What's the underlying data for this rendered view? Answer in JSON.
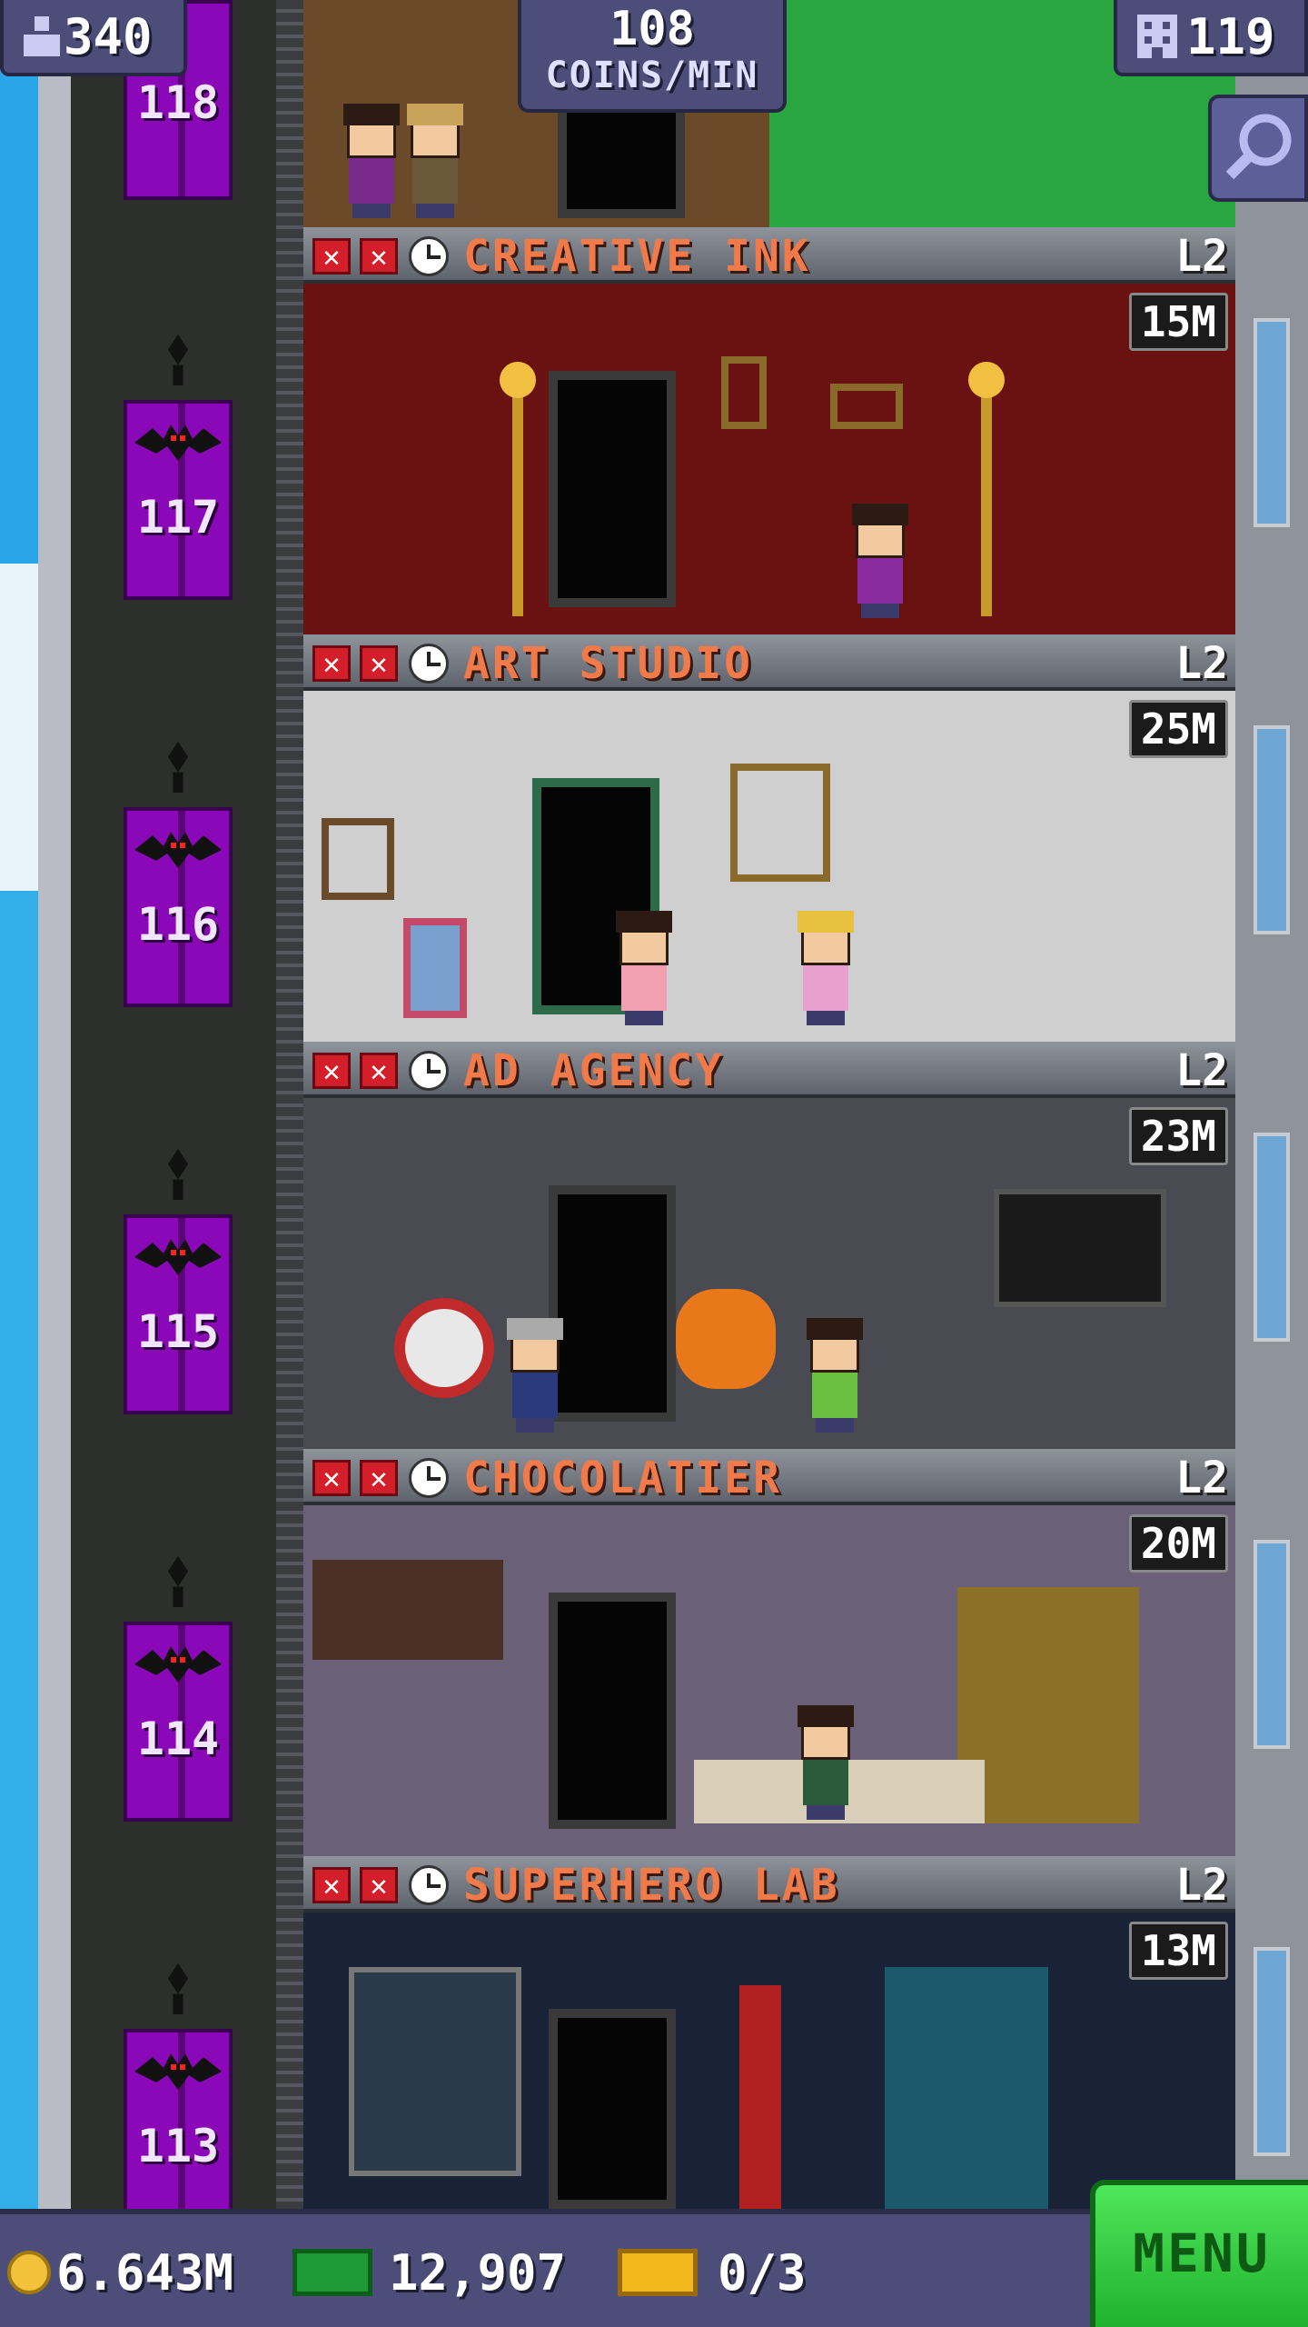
{
  "hud": {
    "population": "340",
    "coins_per_min_value": "108",
    "coins_per_min_label": "COINS/MIN",
    "floors_count": "119"
  },
  "elevator": {
    "floors": [
      "118",
      "117",
      "116",
      "115",
      "114",
      "113"
    ]
  },
  "floors": [
    {
      "name": "CREATIVE INK",
      "level": "L2",
      "timer": "15M"
    },
    {
      "name": "ART STUDIO",
      "level": "L2",
      "timer": "25M"
    },
    {
      "name": "AD AGENCY",
      "level": "L2",
      "timer": "23M"
    },
    {
      "name": "CHOCOLATIER",
      "level": "L2",
      "timer": "20M"
    },
    {
      "name": "SUPERHERO LAB",
      "level": "L2",
      "timer": "13M"
    }
  ],
  "bottom": {
    "coins": "6.643M",
    "bux": "12,907",
    "tickets": "0/3",
    "menu_label": "MENU"
  },
  "colors": {
    "hud_bg": "#4c4d78",
    "floor_name": "#f07a4a",
    "elevator": "#8a08b8",
    "menu": "#3ccf48"
  }
}
